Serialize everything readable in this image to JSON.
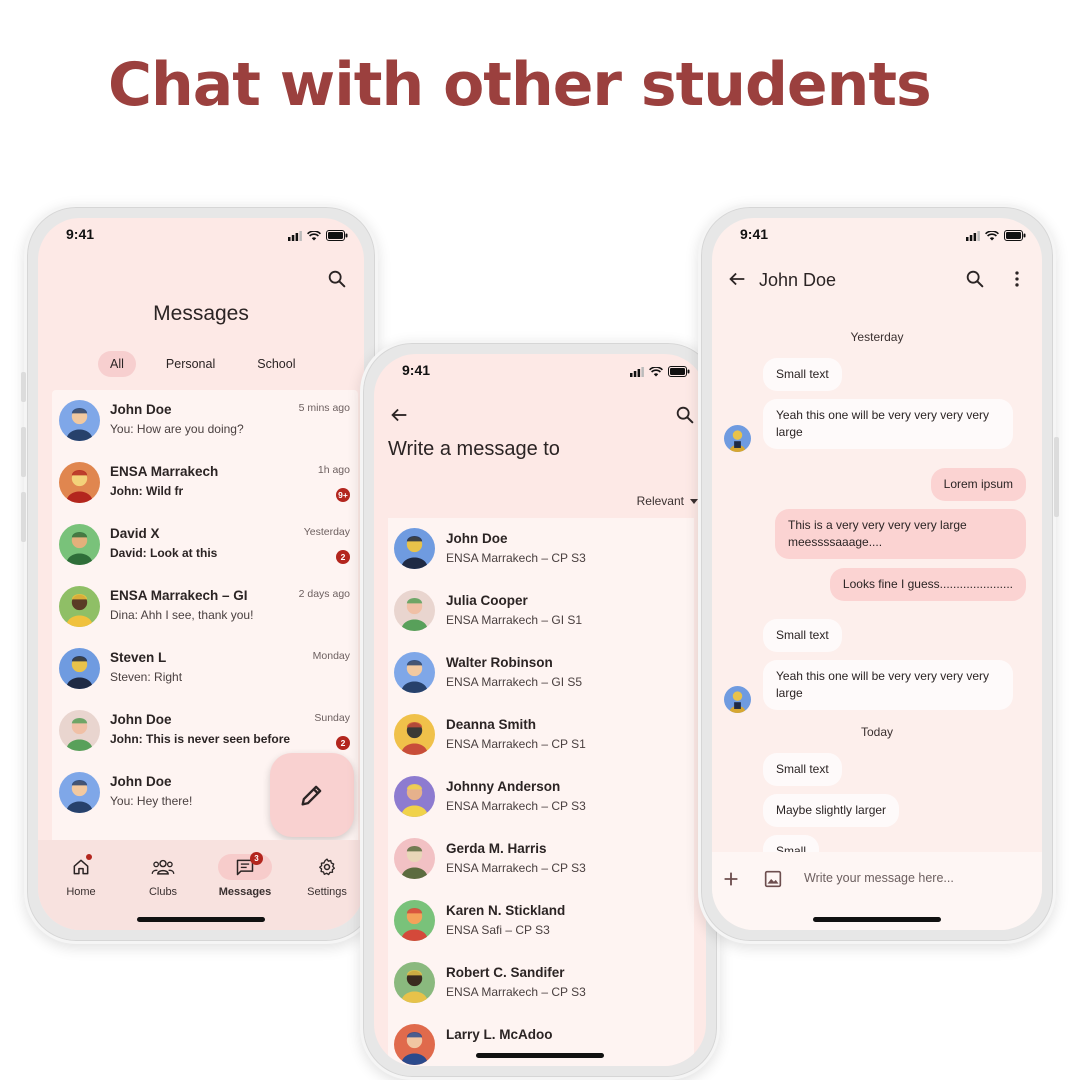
{
  "headline": "Chat with other students",
  "status_time": "9:41",
  "messages_screen": {
    "title": "Messages",
    "filters": [
      "All",
      "Personal",
      "School"
    ],
    "conversations": [
      {
        "name": "John Doe",
        "message": "You: How are you doing?",
        "time": "5 mins ago",
        "badge": "",
        "unread": false
      },
      {
        "name": "ENSA Marrakech",
        "message": "John: Wild fr",
        "time": "1h ago",
        "badge": "9+",
        "unread": true
      },
      {
        "name": "David X",
        "message": "David: Look at this",
        "time": "Yesterday",
        "badge": "2",
        "unread": true
      },
      {
        "name": "ENSA Marrakech – GI",
        "message": "Dina: Ahh I see, thank you!",
        "time": "2 days ago",
        "badge": "",
        "unread": false
      },
      {
        "name": "Steven L",
        "message": "Steven: Right",
        "time": "Monday",
        "badge": "",
        "unread": false
      },
      {
        "name": "John Doe",
        "message": "John: This is never seen before",
        "time": "Sunday",
        "badge": "2",
        "unread": true
      },
      {
        "name": "John Doe",
        "message": "You: Hey there!",
        "time": "",
        "badge": "",
        "unread": false
      }
    ],
    "nav": [
      {
        "label": "Home",
        "icon": "home-icon"
      },
      {
        "label": "Clubs",
        "icon": "groups-icon"
      },
      {
        "label": "Messages",
        "icon": "message-icon",
        "count": "3"
      },
      {
        "label": "Settings",
        "icon": "gear-icon"
      }
    ]
  },
  "new_message_screen": {
    "title": "Write a message to",
    "sort": "Relevant",
    "contacts": [
      {
        "name": "John Doe",
        "sub": "ENSA Marrakech – CP S3"
      },
      {
        "name": "Julia Cooper",
        "sub": "ENSA Marrakech – GI S1"
      },
      {
        "name": "Walter Robinson",
        "sub": "ENSA Marrakech – GI S5"
      },
      {
        "name": "Deanna Smith",
        "sub": "ENSA Marrakech – CP S1"
      },
      {
        "name": "Johnny Anderson",
        "sub": "ENSA Marrakech – CP S3"
      },
      {
        "name": "Gerda M. Harris",
        "sub": "ENSA Marrakech – CP S3"
      },
      {
        "name": "Karen N. Stickland",
        "sub": "ENSA Safi – CP S3"
      },
      {
        "name": "Robert C. Sandifer",
        "sub": "ENSA Marrakech – CP S3"
      },
      {
        "name": "Larry L. McAdoo",
        "sub": ""
      }
    ]
  },
  "chat_screen": {
    "contact_name": "John Doe",
    "day_yesterday": "Yesterday",
    "day_today": "Today",
    "messages": [
      "Small text",
      "Yeah this one will be very very very very large",
      "Lorem ipsum",
      "This is a very very very very large meessssaaage....",
      "Looks fine I guess......................",
      "Small text",
      "Yeah this one will be very very very very large",
      "Small text",
      "Maybe slightly larger",
      "Small"
    ],
    "composer_placeholder": "Write your message here..."
  },
  "colors": {
    "headline": "#9b403e",
    "accent": "#f7cfcf",
    "badge": "#b3261e",
    "outgoing_bubble": "#fbd3d2"
  }
}
